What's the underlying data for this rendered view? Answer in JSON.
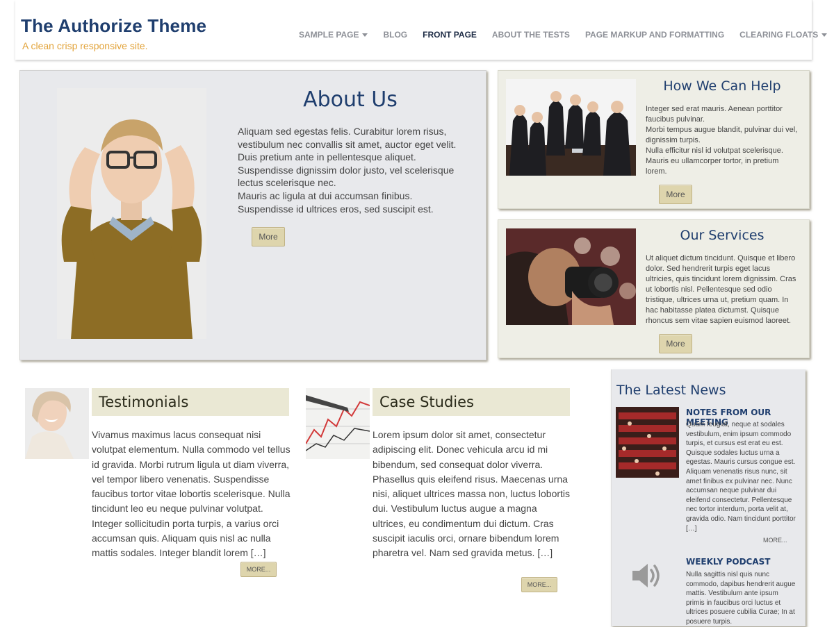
{
  "site": {
    "title": "The Authorize Theme",
    "description": "A clean crisp responsive site."
  },
  "nav": {
    "items": [
      {
        "label": "SAMPLE PAGE",
        "dropdown": true,
        "active": false
      },
      {
        "label": "BLOG",
        "dropdown": false,
        "active": false
      },
      {
        "label": "FRONT PAGE",
        "dropdown": false,
        "active": true
      },
      {
        "label": "ABOUT THE TESTS",
        "dropdown": false,
        "active": false
      },
      {
        "label": "PAGE MARKUP AND FORMATTING",
        "dropdown": false,
        "active": false
      },
      {
        "label": "CLEARING FLOATS",
        "dropdown": true,
        "active": false
      }
    ]
  },
  "about": {
    "title": "About Us",
    "paragraphs": [
      "Aliquam sed egestas felis. Curabitur lorem risus, vestibulum nec convallis sit amet, auctor eget velit.",
      "Duis pretium ante in pellentesque aliquet. Suspendisse dignissim dolor justo, vel scelerisque lectus scelerisque nec.",
      "Mauris ac ligula at dui accumsan finibus. Suspendisse id ultrices eros, sed suscipit est."
    ],
    "button": "More"
  },
  "help": {
    "title": "How We Can Help",
    "paragraphs": [
      "Integer sed erat mauris. Aenean porttitor faucibus pulvinar.",
      "Morbi tempus augue blandit, pulvinar dui vel, dignissim turpis.",
      "Nulla efficitur nisl id volutpat scelerisque. Mauris eu ullamcorper tortor, in pretium lorem."
    ],
    "button": "More"
  },
  "services": {
    "title": "Our Services",
    "paragraphs": [
      "Ut aliquet dictum tincidunt. Quisque et libero dolor. Sed hendrerit turpis eget lacus ultricies, quis tincidunt lorem dignissim. Cras ut lobortis nisl. Pellentesque sed odio tristique, ultrices urna ut, pretium quam. In hac habitasse platea dictumst. Quisque rhoncus sem vitae sapien euismod laoreet."
    ],
    "button": "More"
  },
  "testimonials": {
    "title": "Testimonials",
    "text": "Vivamus maximus lacus consequat nisi volutpat elementum. Nulla commodo vel tellus id gravida. Morbi rutrum ligula ut diam viverra, vel tempor libero venenatis. Suspendisse faucibus tortor vitae lobortis scelerisque. Nulla tincidunt leo eu neque pulvinar volutpat. Integer sollicitudin porta turpis, a varius orci accumsan quis. Aliquam quis nisl ac nulla mattis sodales. Integer blandit lorem […]",
    "button": "MORE..."
  },
  "case_studies": {
    "title": "Case Studies",
    "text": "Lorem ipsum dolor sit amet, consectetur adipiscing elit. Donec vehicula arcu id mi bibendum, sed consequat dolor viverra. Phasellus quis eleifend risus. Maecenas urna nisi, aliquet ultrices massa non, luctus lobortis dui. Vestibulum luctus augue a magna ultrices, eu condimentum dui dictum. Cras suscipit iaculis orci, ornare bibendum lorem pharetra vel. Nam sed gravida metus. […]",
    "button": "MORE..."
  },
  "news": {
    "title": "The Latest News",
    "items": [
      {
        "title": "NOTES FROM OUR MEETING",
        "text": "Quam feugiat, neque at sodales vestibulum, enim ipsum commodo turpis, et cursus est erat eu est. Quisque sodales luctus urna a egestas. Mauris cursus congue est. Aliquam venenatis risus nunc, sit amet finibus ex pulvinar nec. Nunc accumsan neque pulvinar dui eleifend consectetur. Pellentesque nec tortor interdum, porta velit at, gravida odio. Nam tincidunt porttitor […]",
        "link": "MORE..."
      },
      {
        "title": "WEEKLY PODCAST",
        "text": "Nulla sagittis nisl quis nunc commodo, dapibus hendrerit augue mattis. Vestibulum ante ipsum primis in faucibus orci luctus et ultrices posuere cubilia Curae; In at posuere turpis."
      }
    ]
  },
  "colors": {
    "title_blue": "#1f3e6e",
    "tagline_orange": "#e2a33a",
    "button_tan": "#ded5ad",
    "heading_band": "#eae8d4",
    "panel_gray": "#e8e9ec"
  }
}
